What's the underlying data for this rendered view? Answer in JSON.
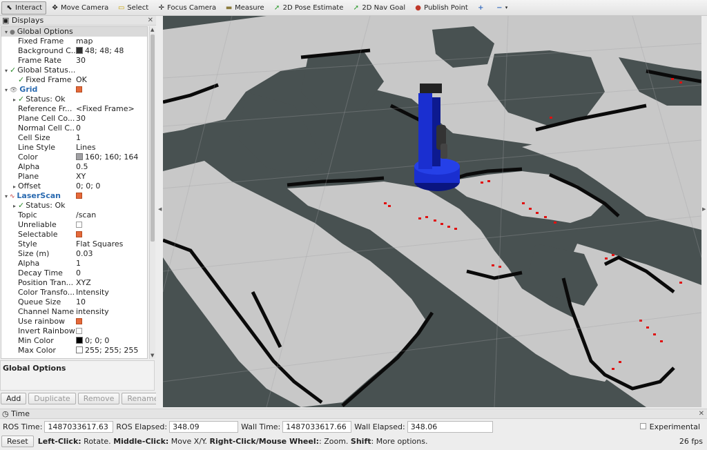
{
  "toolbar": {
    "interact": "Interact",
    "move_camera": "Move Camera",
    "select": "Select",
    "focus_camera": "Focus Camera",
    "measure": "Measure",
    "pose_estimate": "2D Pose Estimate",
    "nav_goal": "2D Nav Goal",
    "publish_point": "Publish Point"
  },
  "displays_panel": {
    "title": "Displays",
    "rows": [
      {
        "key": "Global Options",
        "value": ""
      },
      {
        "key": "Fixed Frame",
        "value": "map"
      },
      {
        "key": "Background C...",
        "value": "48; 48; 48",
        "swatch": "#303030"
      },
      {
        "key": "Frame Rate",
        "value": "30"
      },
      {
        "key": "Global Status...",
        "value": ""
      },
      {
        "key": "Fixed Frame",
        "value": "OK"
      },
      {
        "key": "Grid",
        "value": ""
      },
      {
        "key": "Status: Ok",
        "value": ""
      },
      {
        "key": "Reference Fr...",
        "value": "<Fixed Frame>"
      },
      {
        "key": "Plane Cell Co...",
        "value": "30"
      },
      {
        "key": "Normal Cell C...",
        "value": "0"
      },
      {
        "key": "Cell Size",
        "value": "1"
      },
      {
        "key": "Line Style",
        "value": "Lines"
      },
      {
        "key": "Color",
        "value": "160; 160; 164",
        "swatch": "#a0a0a4"
      },
      {
        "key": "Alpha",
        "value": "0.5"
      },
      {
        "key": "Plane",
        "value": "XY"
      },
      {
        "key": "Offset",
        "value": "0; 0; 0"
      },
      {
        "key": "LaserScan",
        "value": ""
      },
      {
        "key": "Status: Ok",
        "value": ""
      },
      {
        "key": "Topic",
        "value": "/scan"
      },
      {
        "key": "Unreliable",
        "value": ""
      },
      {
        "key": "Selectable",
        "value": ""
      },
      {
        "key": "Style",
        "value": "Flat Squares"
      },
      {
        "key": "Size (m)",
        "value": "0.03"
      },
      {
        "key": "Alpha",
        "value": "1"
      },
      {
        "key": "Decay Time",
        "value": "0"
      },
      {
        "key": "Position Tran...",
        "value": "XYZ"
      },
      {
        "key": "Color Transfo...",
        "value": "Intensity"
      },
      {
        "key": "Queue Size",
        "value": "10"
      },
      {
        "key": "Channel Name",
        "value": "intensity"
      },
      {
        "key": "Use rainbow",
        "value": ""
      },
      {
        "key": "Invert Rainbow",
        "value": ""
      },
      {
        "key": "Min Color",
        "value": "0; 0; 0",
        "swatch": "#000000"
      },
      {
        "key": "Max Color",
        "value": "255; 255; 255",
        "swatch": "#ffffff"
      }
    ],
    "description": "Global Options",
    "buttons": {
      "add": "Add",
      "duplicate": "Duplicate",
      "remove": "Remove",
      "rename": "Rename"
    }
  },
  "time_panel": {
    "title": "Time",
    "ros_time_label": "ROS Time:",
    "ros_time": "1487033617.63",
    "ros_elapsed_label": "ROS Elapsed:",
    "ros_elapsed": "348.09",
    "wall_time_label": "Wall Time:",
    "wall_time": "1487033617.66",
    "wall_elapsed_label": "Wall Elapsed:",
    "wall_elapsed": "348.06",
    "experimental": "Experimental"
  },
  "status_bar": {
    "reset": "Reset",
    "left_click_label": "Left-Click:",
    "left_click": " Rotate. ",
    "middle_click_label": "Middle-Click:",
    "middle_click": " Move X/Y. ",
    "right_click_label": "Right-Click/Mouse Wheel:",
    "right_click": ": Zoom. ",
    "shift_label": "Shift",
    "shift": ": More options.",
    "fps": "26 fps"
  },
  "colors": {
    "background": "#485151",
    "free_space": "#c8c8c8",
    "occupied": "#0a0a0a",
    "laser": "#e01010",
    "robot": "#1a2fd0"
  }
}
